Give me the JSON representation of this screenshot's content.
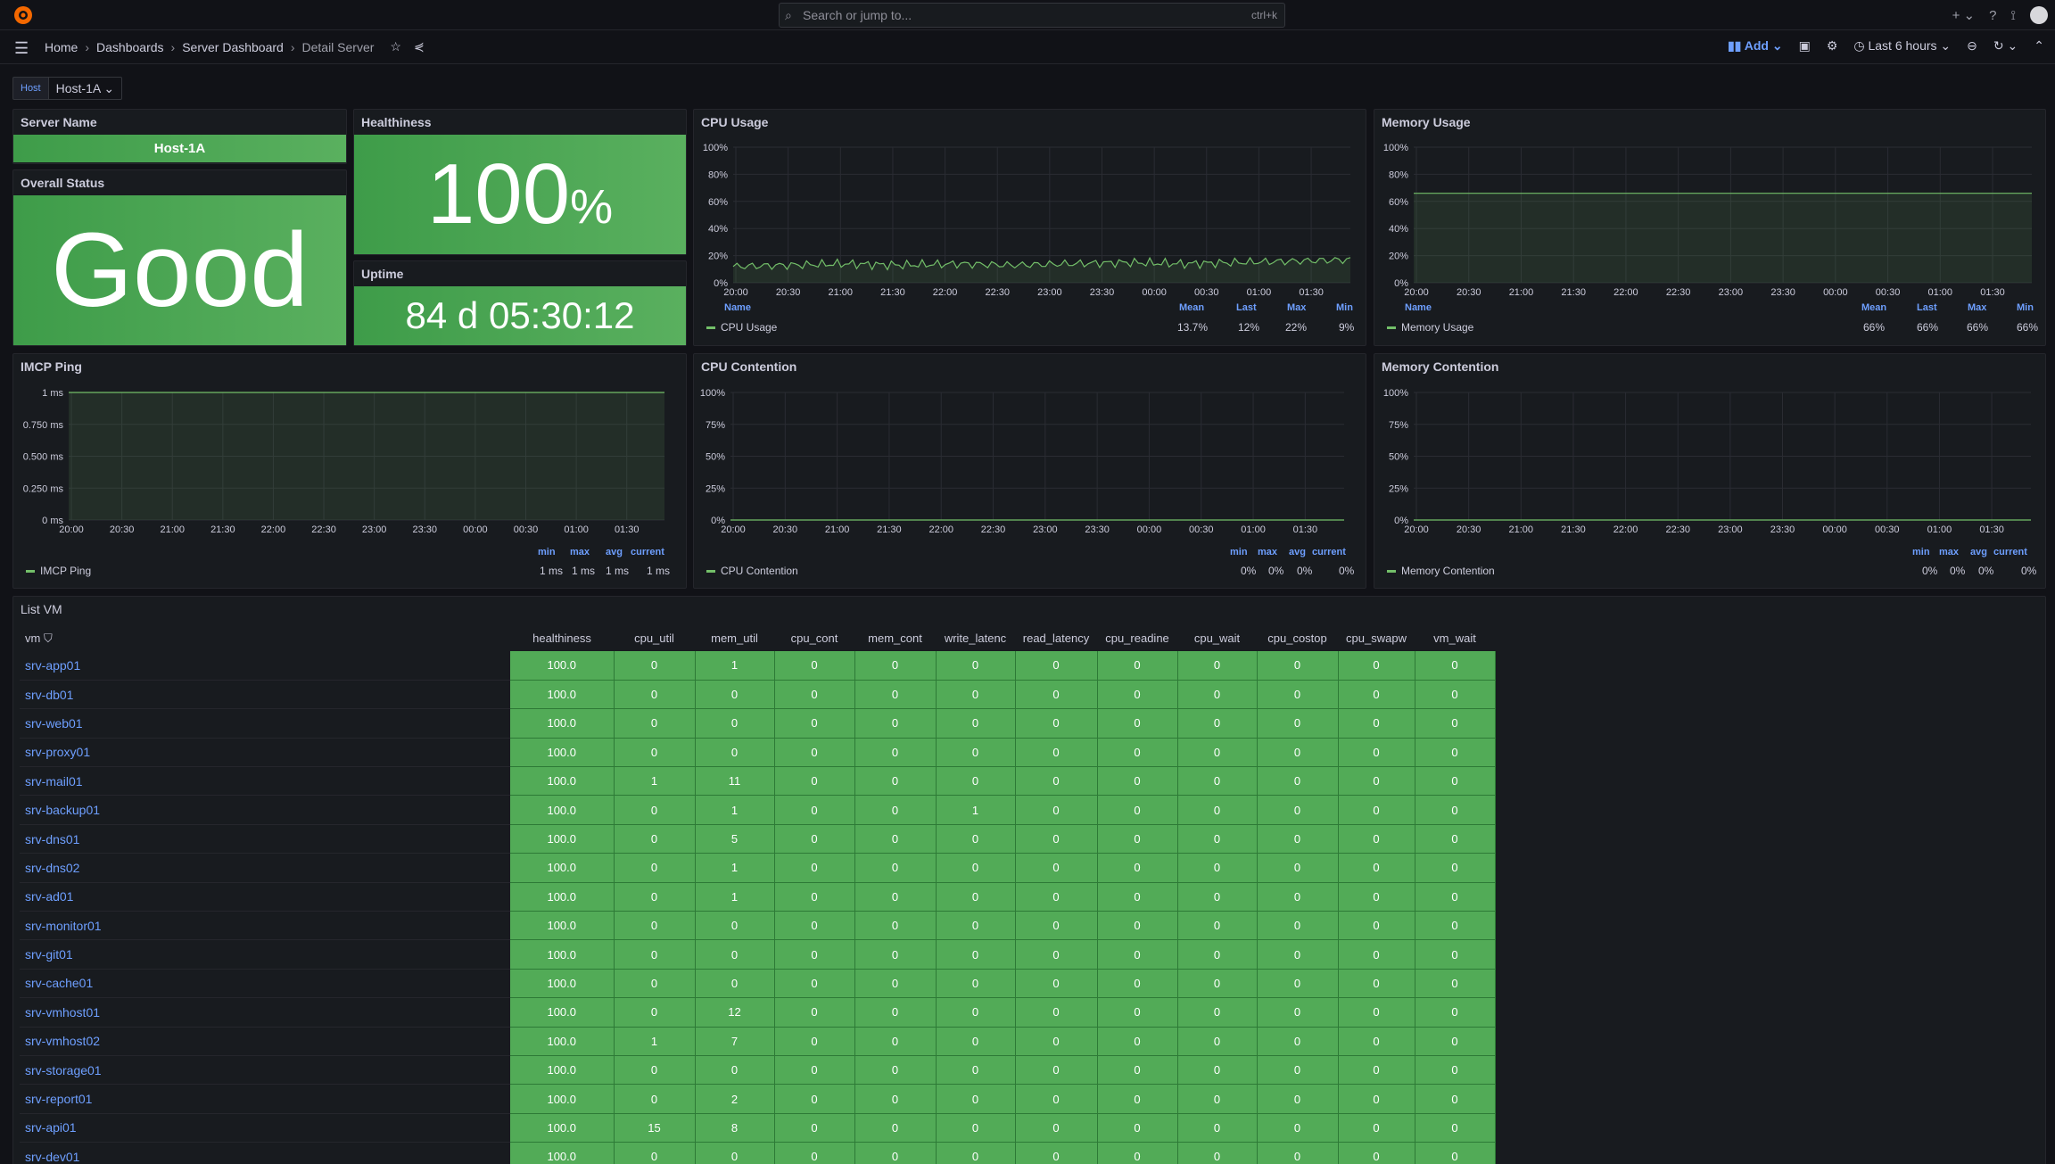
{
  "topbar": {
    "search_placeholder": "Search or jump to...",
    "search_shortcut": "ctrl+k"
  },
  "breadcrumb": [
    "Home",
    "Dashboards",
    "Server Dashboard",
    "Detail Server"
  ],
  "toolbar": {
    "add_label": "Add",
    "time_range": "Last 6 hours"
  },
  "variable": {
    "label": "Host",
    "value": "Host-1A"
  },
  "server_name": {
    "title": "Server Name",
    "value": "Host-1A"
  },
  "overall_status": {
    "title": "Overall Status",
    "value": "Good"
  },
  "healthiness": {
    "title": "Healthiness",
    "value": "100",
    "unit": "%"
  },
  "uptime": {
    "title": "Uptime",
    "value": "84 d 05:30:12"
  },
  "cpu_usage": {
    "title": "CPU Usage",
    "legend_name_header": "Name",
    "legend_headers": [
      "Mean",
      "Last",
      "Max",
      "Min"
    ],
    "series_name": "CPU Usage",
    "legend_values": [
      "13.7%",
      "12%",
      "22%",
      "9%"
    ]
  },
  "memory_usage": {
    "title": "Memory Usage",
    "legend_name_header": "Name",
    "legend_headers": [
      "Mean",
      "Last",
      "Max",
      "Min"
    ],
    "series_name": "Memory Usage",
    "legend_values": [
      "66%",
      "66%",
      "66%",
      "66%"
    ]
  },
  "icmp_ping": {
    "title": "IMCP Ping",
    "legend_headers": [
      "min",
      "max",
      "avg",
      "current"
    ],
    "series_name": "IMCP Ping",
    "legend_values": [
      "1 ms",
      "1 ms",
      "1 ms",
      "1 ms"
    ]
  },
  "cpu_contention": {
    "title": "CPU Contention",
    "legend_headers": [
      "min",
      "max",
      "avg",
      "current"
    ],
    "series_name": "CPU Contention",
    "legend_values": [
      "0%",
      "0%",
      "0%",
      "0%"
    ]
  },
  "memory_contention": {
    "title": "Memory Contention",
    "legend_headers": [
      "min",
      "max",
      "avg",
      "current"
    ],
    "series_name": "Memory Contention",
    "legend_values": [
      "0%",
      "0%",
      "0%",
      "0%"
    ]
  },
  "chart_data": [
    {
      "type": "line",
      "title": "CPU Usage",
      "x": [
        "20:00",
        "20:30",
        "21:00",
        "21:30",
        "22:00",
        "22:30",
        "23:00",
        "23:30",
        "00:00",
        "00:30",
        "01:00",
        "01:30"
      ],
      "yticks": [
        "0%",
        "20%",
        "40%",
        "60%",
        "80%",
        "100%"
      ],
      "ylim": [
        0,
        100
      ],
      "series": [
        {
          "name": "CPU Usage",
          "values": [
            12,
            13,
            14,
            13,
            14,
            13,
            14,
            15,
            14,
            15,
            16,
            17
          ]
        }
      ]
    },
    {
      "type": "area",
      "title": "Memory Usage",
      "x": [
        "20:00",
        "20:30",
        "21:00",
        "21:30",
        "22:00",
        "22:30",
        "23:00",
        "23:30",
        "00:00",
        "00:30",
        "01:00",
        "01:30"
      ],
      "yticks": [
        "0%",
        "20%",
        "40%",
        "60%",
        "80%",
        "100%"
      ],
      "ylim": [
        0,
        100
      ],
      "series": [
        {
          "name": "Memory Usage",
          "values": [
            66,
            66,
            66,
            66,
            66,
            66,
            66,
            66,
            66,
            66,
            66,
            66
          ]
        }
      ]
    },
    {
      "type": "area",
      "title": "IMCP Ping",
      "x": [
        "20:00",
        "20:30",
        "21:00",
        "21:30",
        "22:00",
        "22:30",
        "23:00",
        "23:30",
        "00:00",
        "00:30",
        "01:00",
        "01:30"
      ],
      "yticks": [
        "0 ms",
        "0.250 ms",
        "0.500 ms",
        "0.750 ms",
        "1 ms"
      ],
      "ylim": [
        0,
        1
      ],
      "series": [
        {
          "name": "IMCP Ping",
          "values": [
            1,
            1,
            1,
            1,
            1,
            1,
            1,
            1,
            1,
            1,
            1,
            1
          ]
        }
      ]
    },
    {
      "type": "line",
      "title": "CPU Contention",
      "x": [
        "20:00",
        "20:30",
        "21:00",
        "21:30",
        "22:00",
        "22:30",
        "23:00",
        "23:30",
        "00:00",
        "00:30",
        "01:00",
        "01:30"
      ],
      "yticks": [
        "0%",
        "25%",
        "50%",
        "75%",
        "100%"
      ],
      "ylim": [
        0,
        100
      ],
      "series": [
        {
          "name": "CPU Contention",
          "values": [
            0,
            0,
            0,
            0,
            0,
            0,
            0,
            0,
            0,
            0,
            0,
            0
          ]
        }
      ]
    },
    {
      "type": "line",
      "title": "Memory Contention",
      "x": [
        "20:00",
        "20:30",
        "21:00",
        "21:30",
        "22:00",
        "22:30",
        "23:00",
        "23:30",
        "00:00",
        "00:30",
        "01:00",
        "01:30"
      ],
      "yticks": [
        "0%",
        "25%",
        "50%",
        "75%",
        "100%"
      ],
      "ylim": [
        0,
        100
      ],
      "series": [
        {
          "name": "Memory Contention",
          "values": [
            0,
            0,
            0,
            0,
            0,
            0,
            0,
            0,
            0,
            0,
            0,
            0
          ]
        }
      ]
    }
  ],
  "vm_table": {
    "title": "List VM",
    "columns": [
      "vm",
      "healthiness",
      "cpu_util",
      "mem_util",
      "cpu_cont",
      "mem_cont",
      "write_latenc",
      "read_latency",
      "cpu_readine",
      "cpu_wait",
      "cpu_costop",
      "cpu_swapw",
      "vm_wait"
    ],
    "rows": [
      [
        "srv-app01",
        "100.0",
        "0",
        "1",
        "0",
        "0",
        "0",
        "0",
        "0",
        "0",
        "0",
        "0",
        "0"
      ],
      [
        "srv-db01",
        "100.0",
        "0",
        "0",
        "0",
        "0",
        "0",
        "0",
        "0",
        "0",
        "0",
        "0",
        "0"
      ],
      [
        "srv-web01",
        "100.0",
        "0",
        "0",
        "0",
        "0",
        "0",
        "0",
        "0",
        "0",
        "0",
        "0",
        "0"
      ],
      [
        "srv-proxy01",
        "100.0",
        "0",
        "0",
        "0",
        "0",
        "0",
        "0",
        "0",
        "0",
        "0",
        "0",
        "0"
      ],
      [
        "srv-mail01",
        "100.0",
        "1",
        "11",
        "0",
        "0",
        "0",
        "0",
        "0",
        "0",
        "0",
        "0",
        "0"
      ],
      [
        "srv-backup01",
        "100.0",
        "0",
        "1",
        "0",
        "0",
        "1",
        "0",
        "0",
        "0",
        "0",
        "0",
        "0"
      ],
      [
        "srv-dns01",
        "100.0",
        "0",
        "5",
        "0",
        "0",
        "0",
        "0",
        "0",
        "0",
        "0",
        "0",
        "0"
      ],
      [
        "srv-dns02",
        "100.0",
        "0",
        "1",
        "0",
        "0",
        "0",
        "0",
        "0",
        "0",
        "0",
        "0",
        "0"
      ],
      [
        "srv-ad01",
        "100.0",
        "0",
        "1",
        "0",
        "0",
        "0",
        "0",
        "0",
        "0",
        "0",
        "0",
        "0"
      ],
      [
        "srv-monitor01",
        "100.0",
        "0",
        "0",
        "0",
        "0",
        "0",
        "0",
        "0",
        "0",
        "0",
        "0",
        "0"
      ],
      [
        "srv-git01",
        "100.0",
        "0",
        "0",
        "0",
        "0",
        "0",
        "0",
        "0",
        "0",
        "0",
        "0",
        "0"
      ],
      [
        "srv-cache01",
        "100.0",
        "0",
        "0",
        "0",
        "0",
        "0",
        "0",
        "0",
        "0",
        "0",
        "0",
        "0"
      ],
      [
        "srv-vmhost01",
        "100.0",
        "0",
        "12",
        "0",
        "0",
        "0",
        "0",
        "0",
        "0",
        "0",
        "0",
        "0"
      ],
      [
        "srv-vmhost02",
        "100.0",
        "1",
        "7",
        "0",
        "0",
        "0",
        "0",
        "0",
        "0",
        "0",
        "0",
        "0"
      ],
      [
        "srv-storage01",
        "100.0",
        "0",
        "0",
        "0",
        "0",
        "0",
        "0",
        "0",
        "0",
        "0",
        "0",
        "0"
      ],
      [
        "srv-report01",
        "100.0",
        "0",
        "2",
        "0",
        "0",
        "0",
        "0",
        "0",
        "0",
        "0",
        "0",
        "0"
      ],
      [
        "srv-api01",
        "100.0",
        "15",
        "8",
        "0",
        "0",
        "0",
        "0",
        "0",
        "0",
        "0",
        "0",
        "0"
      ],
      [
        "srv-dev01",
        "100.0",
        "0",
        "0",
        "0",
        "0",
        "0",
        "0",
        "0",
        "0",
        "0",
        "0",
        "0"
      ]
    ]
  }
}
